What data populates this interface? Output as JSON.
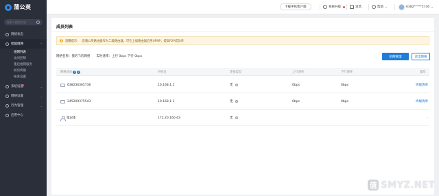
{
  "app": {
    "name": "蒲公英"
  },
  "sidebar": {
    "search_placeholder": "搜索人搜索内容",
    "items": [
      {
        "label": "网络状态"
      },
      {
        "label": "智能组网",
        "active": true,
        "children": [
          {
            "label": "组网列表",
            "active": true
          },
          {
            "label": "访问控制"
          },
          {
            "label": "重启组网服务"
          },
          {
            "label": "如何传输"
          },
          {
            "label": "帐发设置"
          }
        ]
      },
      {
        "label": "系统设置"
      },
      {
        "label": "网络设置"
      },
      {
        "label": "行为管理"
      },
      {
        "label": "应用中心"
      }
    ]
  },
  "header": {
    "download_label": "下载手机客户端",
    "upgrade_label": "系统升级",
    "alert_label": "消息",
    "help_label": "帮助",
    "account": "6382*****5736"
  },
  "page": {
    "title": "成员列表",
    "notice_prefix": "温馨提示：",
    "notice": "您蒲公英路由器作为二级路由器，可在上级路由器启用UPNP，提高P2P成功率",
    "network_name_label": "网络名称：",
    "network_name": "我的飞的网络",
    "rate_label": "实时速率：",
    "rate_up": "上行 0bps",
    "rate_down": "下行 0bps",
    "btn_manage": "组网管理",
    "btn_exit": "退出网络"
  },
  "table": {
    "columns": [
      "网络成员",
      "IP地址",
      "连接类型",
      "上行速率",
      "下行速率",
      "操作"
    ],
    "sort_badges": [
      "3",
      "2"
    ],
    "rows": [
      {
        "name": "638236365736",
        "ip": "10.168.1.1",
        "type": "无",
        "up": "0bps",
        "down": "0bps",
        "op": "终端清单",
        "icon": "router-icon"
      },
      {
        "name": "245209375543",
        "ip": "10.168.1.1",
        "type": "无",
        "up": "0bps",
        "down": "0bps",
        "op": "终端清单",
        "icon": "router-icon"
      },
      {
        "name": "笔记本",
        "ip": "172.20.160.63",
        "type": "无",
        "up": "",
        "down": "",
        "op": "-",
        "icon": "person-icon"
      }
    ]
  },
  "watermark": {
    "text": "SMYZ.NET",
    "badge": "值"
  },
  "colors": {
    "accent": "#1e7dd9",
    "sidebar_bg": "#2a2f3a",
    "notice_bg": "#fdf5e1"
  }
}
